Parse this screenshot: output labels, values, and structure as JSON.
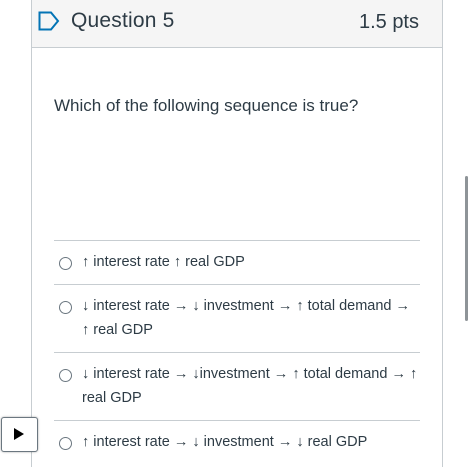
{
  "question": {
    "title": "Question 5",
    "points": "1.5 pts",
    "text": "Which of the following sequence is true?"
  },
  "answers": [
    {
      "label": "↑ interest rate ↑ real GDP"
    },
    {
      "label": "↓ interest rate → ↓ investment → ↑ total demand → ↑ real GDP"
    },
    {
      "label": "↓ interest rate → ↓investment → ↑ total demand → ↑ real GDP"
    },
    {
      "label": "↑ interest rate → ↓ investment → ↓ real GDP"
    }
  ],
  "icons": {
    "flag": "bookmark-flag-icon",
    "play": "play-icon"
  },
  "colors": {
    "accent": "#0374b5",
    "text": "#2d3b45",
    "border": "#c7cdd1",
    "header_bg": "#f5f5f5"
  }
}
